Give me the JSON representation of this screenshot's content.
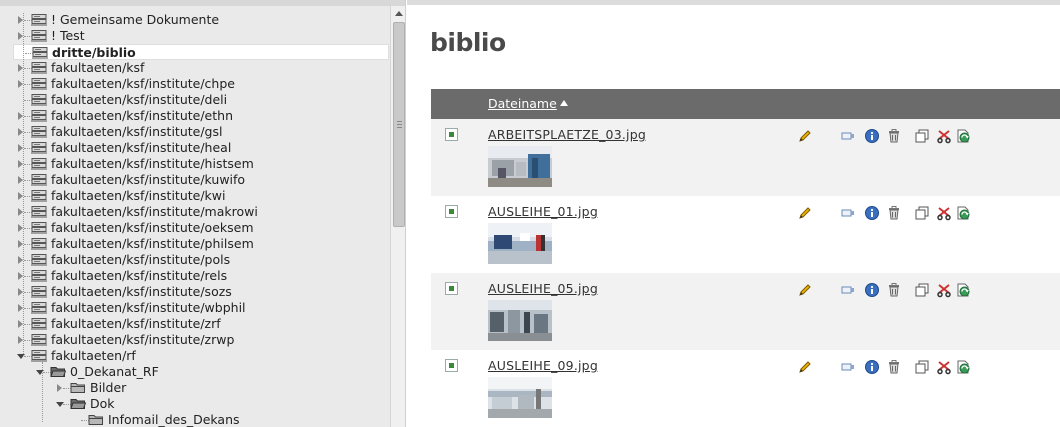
{
  "tree": {
    "items": [
      {
        "label": "! Gemeinsame Dokumente",
        "kind": "drive",
        "expander": "collapsed",
        "level": 0
      },
      {
        "label": "! Test",
        "kind": "drive",
        "expander": "collapsed",
        "level": 0
      },
      {
        "label": "dritte/biblio",
        "kind": "drive",
        "expander": "none",
        "level": 0,
        "selected": true
      },
      {
        "label": "fakultaeten/ksf",
        "kind": "drive",
        "expander": "collapsed",
        "level": 0
      },
      {
        "label": "fakultaeten/ksf/institute/chpe",
        "kind": "drive",
        "expander": "collapsed",
        "level": 0
      },
      {
        "label": "fakultaeten/ksf/institute/deli",
        "kind": "drive",
        "expander": "none",
        "level": 0
      },
      {
        "label": "fakultaeten/ksf/institute/ethn",
        "kind": "drive",
        "expander": "collapsed",
        "level": 0
      },
      {
        "label": "fakultaeten/ksf/institute/gsl",
        "kind": "drive",
        "expander": "collapsed",
        "level": 0
      },
      {
        "label": "fakultaeten/ksf/institute/heal",
        "kind": "drive",
        "expander": "collapsed",
        "level": 0
      },
      {
        "label": "fakultaeten/ksf/institute/histsem",
        "kind": "drive",
        "expander": "collapsed",
        "level": 0
      },
      {
        "label": "fakultaeten/ksf/institute/kuwifo",
        "kind": "drive",
        "expander": "collapsed",
        "level": 0
      },
      {
        "label": "fakultaeten/ksf/institute/kwi",
        "kind": "drive",
        "expander": "collapsed",
        "level": 0
      },
      {
        "label": "fakultaeten/ksf/institute/makrowi",
        "kind": "drive",
        "expander": "collapsed",
        "level": 0
      },
      {
        "label": "fakultaeten/ksf/institute/oeksem",
        "kind": "drive",
        "expander": "collapsed",
        "level": 0
      },
      {
        "label": "fakultaeten/ksf/institute/philsem",
        "kind": "drive",
        "expander": "collapsed",
        "level": 0
      },
      {
        "label": "fakultaeten/ksf/institute/pols",
        "kind": "drive",
        "expander": "collapsed",
        "level": 0
      },
      {
        "label": "fakultaeten/ksf/institute/rels",
        "kind": "drive",
        "expander": "collapsed",
        "level": 0
      },
      {
        "label": "fakultaeten/ksf/institute/sozs",
        "kind": "drive",
        "expander": "collapsed",
        "level": 0
      },
      {
        "label": "fakultaeten/ksf/institute/wbphil",
        "kind": "drive",
        "expander": "collapsed",
        "level": 0
      },
      {
        "label": "fakultaeten/ksf/institute/zrf",
        "kind": "drive",
        "expander": "collapsed",
        "level": 0
      },
      {
        "label": "fakultaeten/ksf/institute/zrwp",
        "kind": "drive",
        "expander": "collapsed",
        "level": 0
      },
      {
        "label": "fakultaeten/rf",
        "kind": "drive",
        "expander": "expanded",
        "level": 0
      },
      {
        "label": "0_Dekanat_RF",
        "kind": "folder-open",
        "expander": "expanded",
        "level": 1
      },
      {
        "label": "Bilder",
        "kind": "folder",
        "expander": "collapsed",
        "level": 2
      },
      {
        "label": "Dok",
        "kind": "folder-open",
        "expander": "expanded",
        "level": 2
      },
      {
        "label": "Infomail_des_Dekans",
        "kind": "folder",
        "expander": "none",
        "level": 3
      }
    ]
  },
  "page": {
    "title": "biblio"
  },
  "table": {
    "column_filename": "Dateiname",
    "sort": "ascending",
    "files": [
      {
        "name": "ARBEITSPLAETZE_03.jpg"
      },
      {
        "name": "AUSLEIHE_01.jpg"
      },
      {
        "name": "AUSLEIHE_05.jpg"
      },
      {
        "name": "AUSLEIHE_09.jpg"
      }
    ],
    "action_icons": [
      "pencil-icon",
      "display-icon",
      "info-icon",
      "trash-icon",
      "copy-icon",
      "cut-icon",
      "replace-icon"
    ]
  },
  "colors": {
    "header_bg": "#6b6b6b",
    "row_alt_bg": "#f2f2f2",
    "tree_bg": "#eaeaea"
  }
}
